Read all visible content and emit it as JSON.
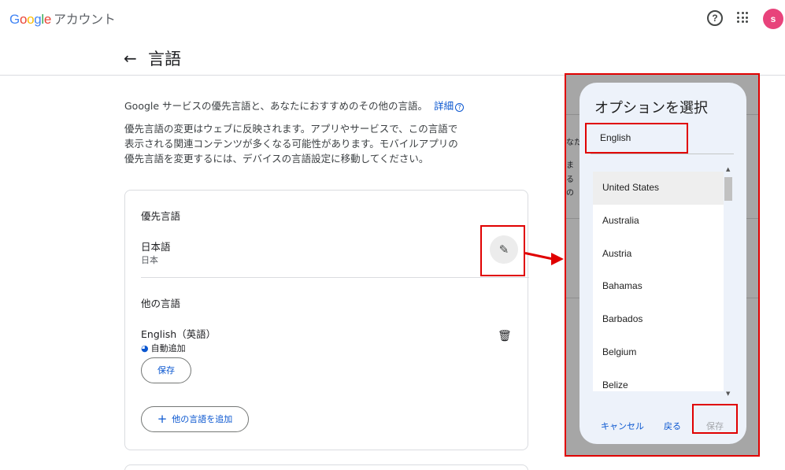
{
  "header": {
    "logo_letters": [
      "G",
      "o",
      "o",
      "g",
      "l",
      "e"
    ],
    "product": "アカウント",
    "help_glyph": "?",
    "avatar_initial": "s",
    "icons": [
      "help-icon",
      "apps-icon",
      "avatar"
    ]
  },
  "page": {
    "back_glyph": "←",
    "title": "言語",
    "intro": "Google サービスの優先言語と、あなたにおすすめのその他の言語。",
    "intro_link": "詳細",
    "description_lines": [
      "優先言語の変更はウェブに反映されます。アプリやサービスで、この言語で",
      "表示される関連コンテンツが多くなる可能性があります。モバイルアプリの",
      "優先言語を変更するには、デバイスの言語設定に移動してください。"
    ]
  },
  "preferred": {
    "section_label": "優先言語",
    "language": "日本語",
    "region": "日本",
    "edit_glyph": "✎"
  },
  "other": {
    "section_label": "他の言語",
    "language": "English（英語）",
    "auto_added": "自動追加",
    "save_button": "保存",
    "add_button": "他の言語を追加",
    "trash_glyph": "🗑"
  },
  "overlay_peek": [
    "なた",
    "ま",
    "る",
    "の"
  ],
  "dialog": {
    "title": "オプションを選択",
    "language": "English",
    "options": [
      "United States",
      "Australia",
      "Austria",
      "Bahamas",
      "Barbados",
      "Belgium",
      "Belize"
    ],
    "selected_option": "United States",
    "cancel": "キャンセル",
    "back": "戻る",
    "save": "保存"
  },
  "annotation_color": "#e00000"
}
